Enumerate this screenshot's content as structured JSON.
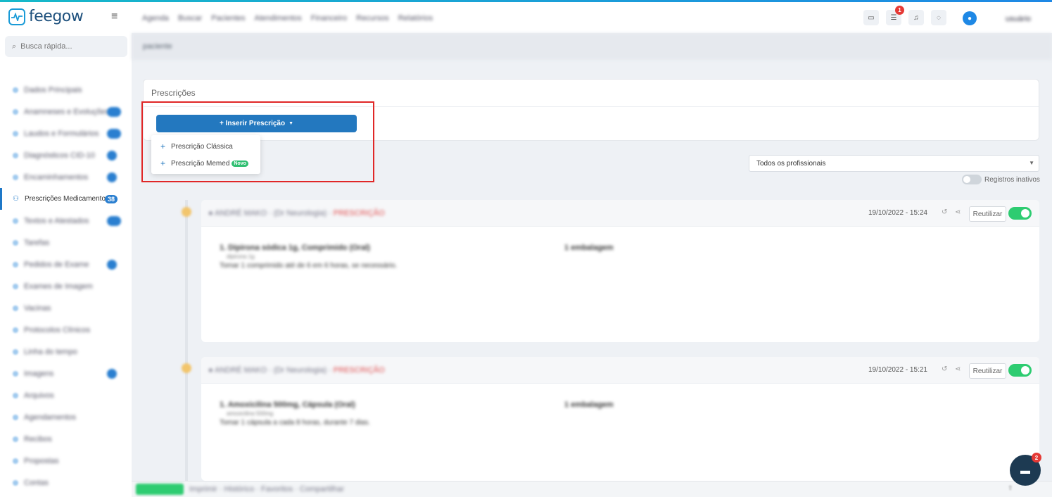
{
  "app": {
    "logo_text": "feegow"
  },
  "topbar": {
    "nav_items": [
      "Agenda",
      "Buscar",
      "Pacientes",
      "Atendimentos",
      "Financeiro",
      "Recursos",
      "Relatórios"
    ],
    "notification_count": "1",
    "user_name": "usuário"
  },
  "sidebar": {
    "search_placeholder": "Busca rápida...",
    "active_label": "Prescrições Medicamentosas",
    "active_count": "38"
  },
  "breadcrumb": {
    "text": "paciente"
  },
  "prescriptions": {
    "panel_title": "Prescrições",
    "insert_button": "+ Inserir Prescrição",
    "menu": [
      {
        "label": "Prescrição Clássica"
      },
      {
        "label": "Prescrição Memed",
        "badge": "Novo"
      }
    ]
  },
  "filter": {
    "selected": "Todos os profissionais",
    "inactive_label": "Registros inativos"
  },
  "records": [
    {
      "date": "19/10/2022 - 15:24",
      "reuse_label": "Reutilizar"
    },
    {
      "date": "19/10/2022 - 15:21",
      "reuse_label": "Reutilizar"
    }
  ],
  "chat": {
    "unread": "2"
  },
  "colors": {
    "primary": "#2378bf",
    "toggle_on": "#2ecc71",
    "highlight_box": "#e02727",
    "badge": "#e53935"
  }
}
